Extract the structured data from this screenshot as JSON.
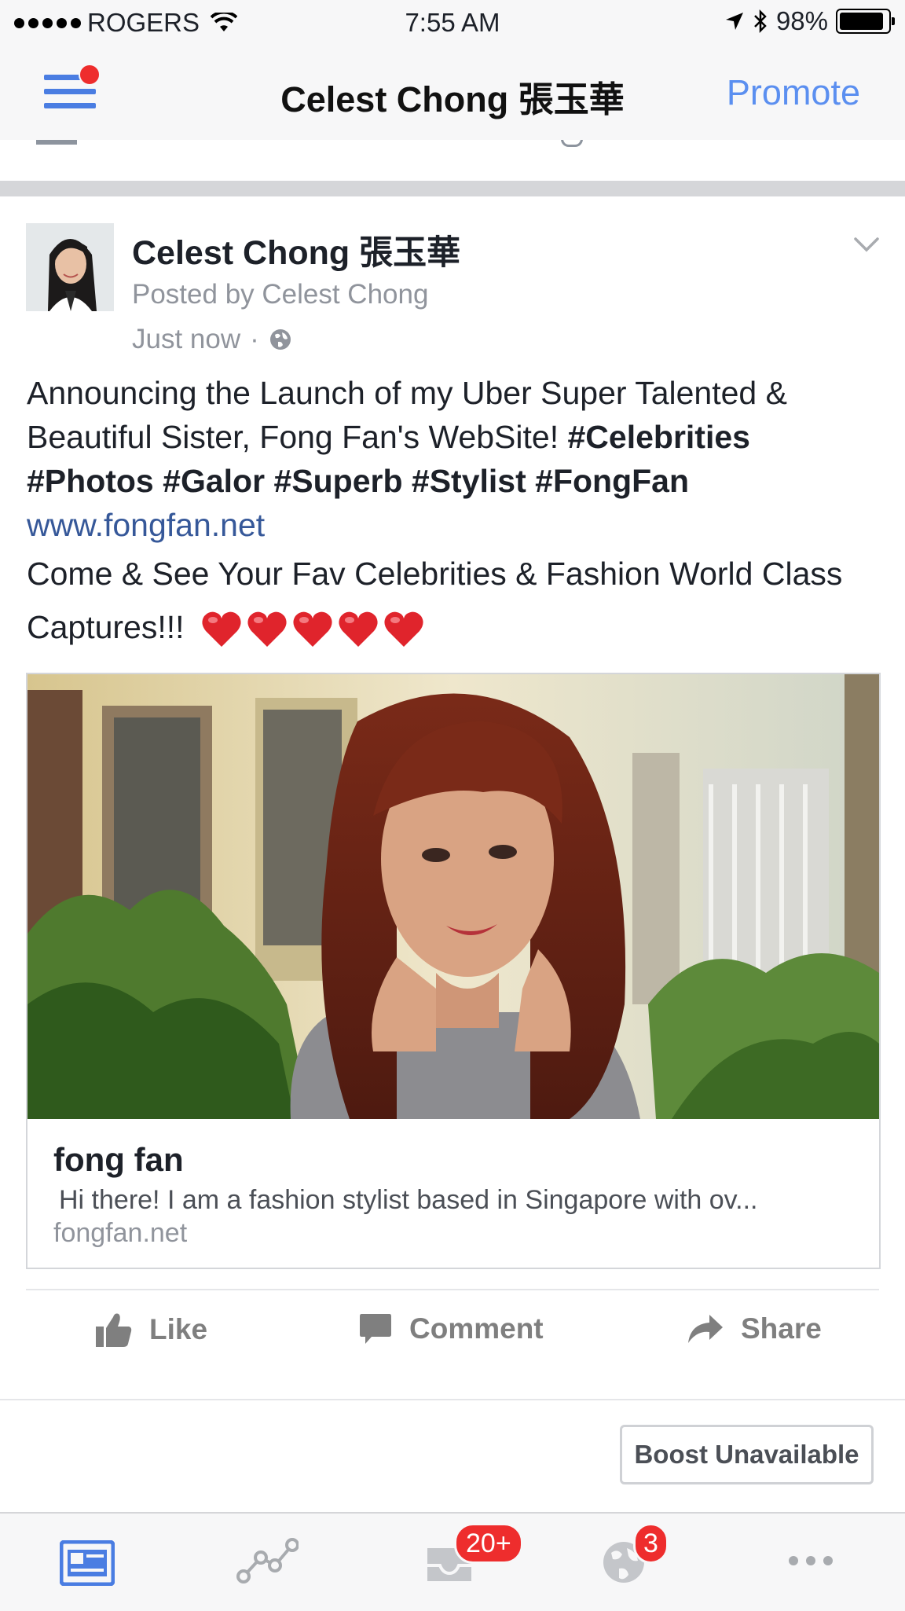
{
  "status_bar": {
    "carrier": "ROGERS",
    "time": "7:55 AM",
    "battery_text": "98%",
    "battery_level": 0.98,
    "icons": [
      "signal-dots-icon",
      "wifi-icon",
      "location-arrow-icon",
      "bluetooth-icon",
      "battery-icon"
    ]
  },
  "nav": {
    "title": "Celest Chong 張玉華",
    "promote_label": "Promote",
    "menu_icon": "hamburger-menu-icon",
    "accent_color": "#5b8ff0",
    "notification_dot_color": "#ee2d2d"
  },
  "post": {
    "page_name": "Celest Chong 張玉華",
    "posted_by": "Posted by Celest Chong",
    "time": "Just now",
    "separator": "·",
    "privacy_icon": "globe-icon",
    "text_line1": "Announcing the Launch of my Uber Super Talented & Beautiful Sister, Fong Fan's WebSite!",
    "hashtags": [
      "#Celebrities",
      "#Photos",
      "#Galor",
      "#Superb",
      "#Stylist",
      "#FongFan"
    ],
    "link_text": "www.fongfan.net",
    "text_line2": "Come & See Your Fav Celebrities & Fashion World Class Captures!!!",
    "emoji": "❤️❤️❤️❤️❤️",
    "heart_count": 5
  },
  "link_card": {
    "title": "fong fan",
    "description": "Hi there! I am a fashion stylist based in Singapore with ov...",
    "domain": "fongfan.net"
  },
  "actions": {
    "like": "Like",
    "comment": "Comment",
    "share": "Share"
  },
  "boost_label": "Boost Unavailable",
  "tab_bar": {
    "tabs": [
      {
        "icon": "news-feed-icon",
        "active": true
      },
      {
        "icon": "insights-icon"
      },
      {
        "icon": "inbox-icon",
        "badge": "20+"
      },
      {
        "icon": "globe-notifications-icon",
        "badge": "3"
      },
      {
        "icon": "more-icon"
      }
    ],
    "active_color": "#4a7de2",
    "badge_color": "#ee2d2d"
  }
}
